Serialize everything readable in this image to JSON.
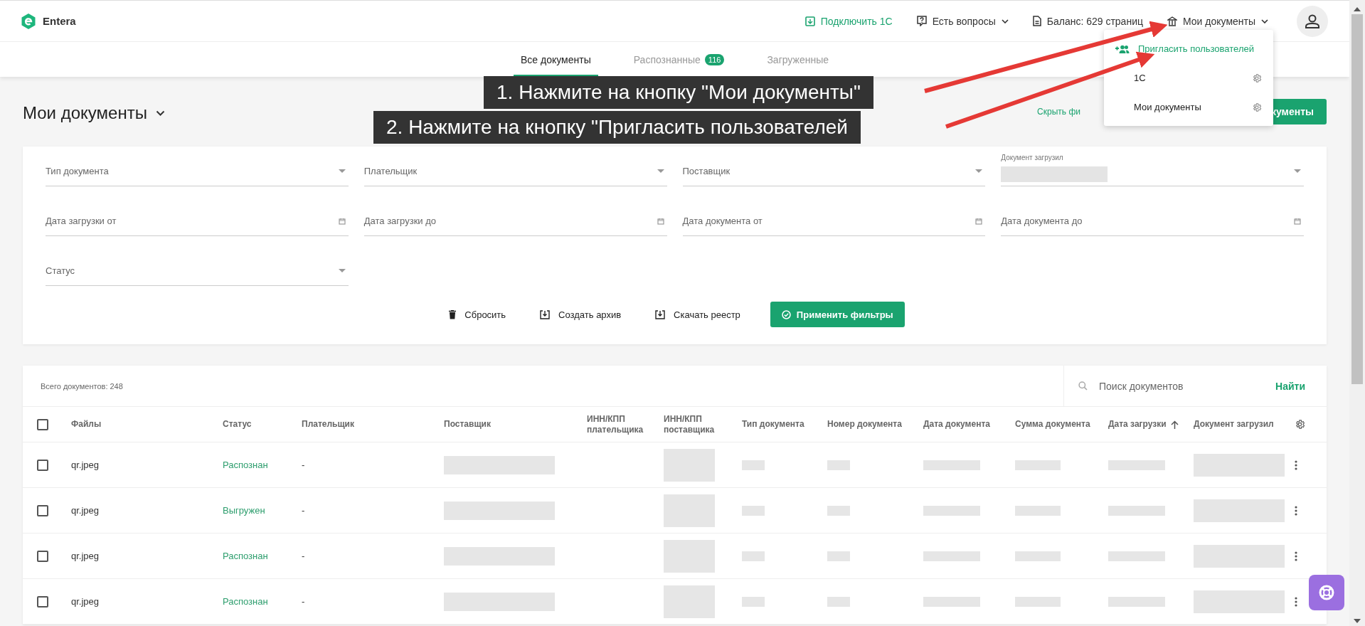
{
  "header": {
    "logo_text": "Entera",
    "nav": [
      {
        "label": "Подключить 1С",
        "kind": "connect"
      },
      {
        "label": "Есть вопросы",
        "kind": "help"
      },
      {
        "label": "Баланс: 629 страниц",
        "kind": "balance"
      },
      {
        "label": "Мои документы",
        "kind": "account"
      }
    ],
    "menu": [
      {
        "label": "Пригласить пользователей",
        "kind": "action"
      },
      {
        "label": "1С",
        "kind": "setting"
      },
      {
        "label": "Мои документы",
        "kind": "setting"
      }
    ]
  },
  "tabs": [
    {
      "label": "Все документы",
      "selected": true
    },
    {
      "label": "Распознанные",
      "badge": "116",
      "selected": false
    },
    {
      "label": "Загруженные",
      "selected": false
    }
  ],
  "page_title": "Мои документы",
  "hide_filters_link": "Скрыть фи",
  "upload_button": "кументы",
  "filters": [
    {
      "label": "Тип документа",
      "kind": "select"
    },
    {
      "label": "Плательщик",
      "kind": "select"
    },
    {
      "label": "Поставщик",
      "kind": "select"
    },
    {
      "label": "Документ загрузил",
      "kind": "redacted"
    },
    {
      "label": "Дата загрузки от",
      "kind": "date"
    },
    {
      "label": "Дата загрузки до",
      "kind": "date"
    },
    {
      "label": "Дата документа от",
      "kind": "date"
    },
    {
      "label": "Дата документа до",
      "kind": "date"
    },
    {
      "label": "Статус",
      "kind": "select"
    }
  ],
  "filter_actions": [
    {
      "label": "Сбросить",
      "kind": "reset"
    },
    {
      "label": "Создать архив",
      "kind": "archive"
    },
    {
      "label": "Скачать реестр",
      "kind": "download"
    },
    {
      "label": "Применить фильтры",
      "kind": "apply"
    }
  ],
  "table": {
    "total": "Всего документов: 248",
    "search_placeholder": "Поиск документов",
    "search_button": "Найти",
    "select_all_checked": false,
    "columns": [
      {
        "label": "Файлы",
        "sorted": false
      },
      {
        "label": "Статус",
        "sorted": false
      },
      {
        "label": "Плательщик",
        "sorted": false
      },
      {
        "label": "Поставщик",
        "sorted": false
      },
      {
        "label": "ИНН/КПП плательщика",
        "sorted": false
      },
      {
        "label": "ИНН/КПП поставщика",
        "sorted": false
      },
      {
        "label": "Тип документа",
        "sorted": false
      },
      {
        "label": "Номер документа",
        "sorted": false
      },
      {
        "label": "Дата документа",
        "sorted": false
      },
      {
        "label": "Сумма документа",
        "sorted": false
      },
      {
        "label": "Дата загрузки",
        "sorted": true
      },
      {
        "label": "Документ загрузил",
        "sorted": false
      }
    ],
    "rows": [
      {
        "file": "qr.jpeg",
        "status": "Распознан",
        "payer": "-",
        "checked": false
      },
      {
        "file": "qr.jpeg",
        "status": "Выгружен",
        "payer": "-",
        "checked": false
      },
      {
        "file": "qr.jpeg",
        "status": "Распознан",
        "payer": "-",
        "checked": false
      },
      {
        "file": "qr.jpeg",
        "status": "Распознан",
        "payer": "-",
        "checked": false
      }
    ]
  },
  "callouts": [
    {
      "text": "1. Нажмите на кнопку \"Мои документы\""
    },
    {
      "text": "2. Нажмите на кнопку \"Пригласить пользователей"
    }
  ]
}
